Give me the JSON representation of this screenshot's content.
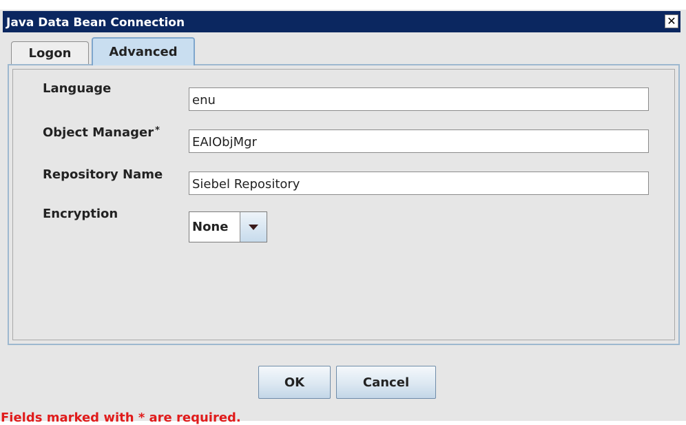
{
  "window": {
    "title": "Java Data Bean Connection",
    "close_glyph": "✕"
  },
  "tabs": [
    {
      "label": "Logon",
      "selected": false
    },
    {
      "label": "Advanced",
      "selected": true
    }
  ],
  "form": {
    "language": {
      "label": "Language",
      "value": "enu"
    },
    "object_manager": {
      "label": "Object Manager",
      "required_mark": "*",
      "value": "EAIObjMgr"
    },
    "repository_name": {
      "label": "Repository Name",
      "value": "Siebel Repository"
    },
    "encryption": {
      "label": "Encryption",
      "selected": "None"
    }
  },
  "buttons": {
    "ok": "OK",
    "cancel": "Cancel"
  },
  "footer": {
    "required_note": "Fields marked with * are required."
  },
  "icons": {
    "close": "close-icon",
    "dropdown": "chevron-down-icon"
  },
  "colors": {
    "title_bar": "#0b2760",
    "selected_tab": "#c9def0",
    "required_note": "#e01b1b"
  }
}
